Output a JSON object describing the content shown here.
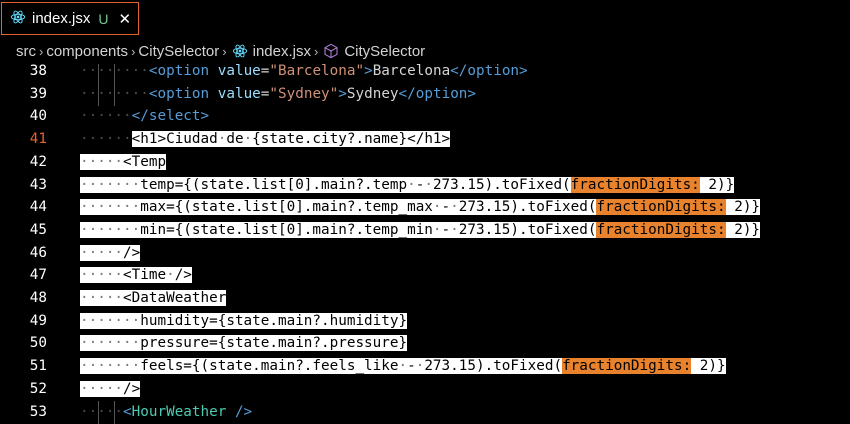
{
  "tab": {
    "filename": "index.jsx",
    "status": "U",
    "close": "✕"
  },
  "breadcrumb": {
    "items": [
      "src",
      "components",
      "CitySelector",
      "index.jsx",
      "CitySelector"
    ],
    "separator": "›"
  },
  "colors": {
    "accent": "#e8622d",
    "selection": "#ffffff",
    "inlay_hint": "#e8822d",
    "react": "#61dafb",
    "component": "#b180d7"
  },
  "lines": [
    {
      "n": "38",
      "ind": "········",
      "parts": [
        [
          "tg",
          "<"
        ],
        [
          "tg",
          "option"
        ],
        [
          "tx",
          " "
        ],
        [
          "an",
          "value"
        ],
        [
          "tx",
          "="
        ],
        [
          "av",
          "\"Barcelona\""
        ],
        [
          "tg",
          ">"
        ],
        [
          "tx",
          "Barcelona"
        ],
        [
          "tg",
          "</"
        ],
        [
          "tg",
          "option"
        ],
        [
          "tg",
          ">"
        ]
      ]
    },
    {
      "n": "39",
      "ind": "········",
      "parts": [
        [
          "tg",
          "<"
        ],
        [
          "tg",
          "option"
        ],
        [
          "tx",
          " "
        ],
        [
          "an",
          "value"
        ],
        [
          "tx",
          "="
        ],
        [
          "av",
          "\"Sydney\""
        ],
        [
          "tg",
          ">"
        ],
        [
          "tx",
          "Sydney"
        ],
        [
          "tg",
          "</"
        ],
        [
          "tg",
          "option"
        ],
        [
          "tg",
          ">"
        ]
      ]
    },
    {
      "n": "40",
      "ind": "······",
      "parts": [
        [
          "tg",
          "</"
        ],
        [
          "tg",
          "select"
        ],
        [
          "tg",
          ">"
        ]
      ]
    },
    {
      "n": "41",
      "active": true,
      "ind": "······",
      "parts": [
        [
          "sel",
          "<h1>Ciudad·de·{state.city?.name}</h1>"
        ]
      ]
    },
    {
      "n": "42",
      "parts": [
        [
          "sel",
          "·····<Temp"
        ]
      ]
    },
    {
      "n": "43",
      "parts": [
        [
          "sel",
          "·······temp={(state.list[0].main?.temp·-·273.15).toFixed("
        ],
        [
          "hint",
          "fractionDigits:"
        ],
        [
          "sel",
          " 2)}"
        ]
      ]
    },
    {
      "n": "44",
      "parts": [
        [
          "sel",
          "·······max={(state.list[0].main?.temp_max·-·273.15).toFixed("
        ],
        [
          "hint",
          "fractionDigits:"
        ],
        [
          "sel",
          " 2)}"
        ]
      ]
    },
    {
      "n": "45",
      "parts": [
        [
          "sel",
          "·······min={(state.list[0].main?.temp_min·-·273.15).toFixed("
        ],
        [
          "hint",
          "fractionDigits:"
        ],
        [
          "sel",
          " 2)}"
        ]
      ]
    },
    {
      "n": "46",
      "parts": [
        [
          "sel",
          "·····/>"
        ]
      ]
    },
    {
      "n": "47",
      "parts": [
        [
          "sel",
          "·····<Time·/>"
        ]
      ]
    },
    {
      "n": "48",
      "parts": [
        [
          "sel",
          "·····<DataWeather"
        ]
      ]
    },
    {
      "n": "49",
      "parts": [
        [
          "sel",
          "·······humidity={state.main?.humidity}"
        ]
      ]
    },
    {
      "n": "50",
      "parts": [
        [
          "sel",
          "·······pressure={state.main?.pressure}"
        ]
      ]
    },
    {
      "n": "51",
      "parts": [
        [
          "sel",
          "·······feels={(state.main?.feels_like·-·273.15).toFixed("
        ],
        [
          "hint",
          "fractionDigits:"
        ],
        [
          "sel",
          " 2)}"
        ]
      ]
    },
    {
      "n": "52",
      "parts": [
        [
          "sel",
          "·····/>"
        ]
      ]
    },
    {
      "n": "53",
      "ind": "·····",
      "parts": [
        [
          "tg",
          "<"
        ],
        [
          "cm",
          "HourWeather"
        ],
        [
          "tx",
          " "
        ],
        [
          "tg",
          "/>"
        ]
      ]
    }
  ]
}
